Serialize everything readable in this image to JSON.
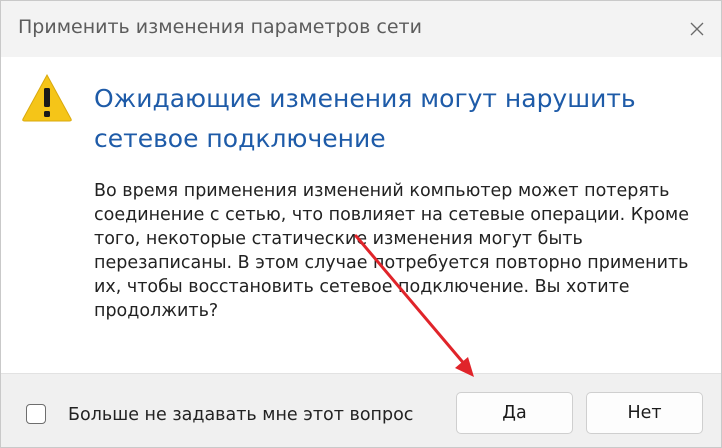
{
  "window": {
    "title": "Применить изменения параметров сети",
    "close_glyph": "✕"
  },
  "content": {
    "icon": "warning-icon",
    "heading_line1": "Ожидающие изменения могут нарушить",
    "heading_line2": "сетевое подключение",
    "message": "Во время применения изменений компьютер может потерять соединение с сетью, что повлияет на сетевые операции. Кроме того, некоторые статические изменения могут быть перезаписаны. В этом случае потребуется повторно применить их, чтобы восстановить сетевое подключение. Вы хотите продолжить?"
  },
  "footer": {
    "checkbox_label": "Больше не задавать мне этот вопрос",
    "checkbox_checked": false,
    "yes_label": "Да",
    "no_label": "Нет"
  },
  "colors": {
    "heading": "#1e5ba8",
    "warning_fill": "#f5c518",
    "annotation_arrow": "#e0242a"
  }
}
